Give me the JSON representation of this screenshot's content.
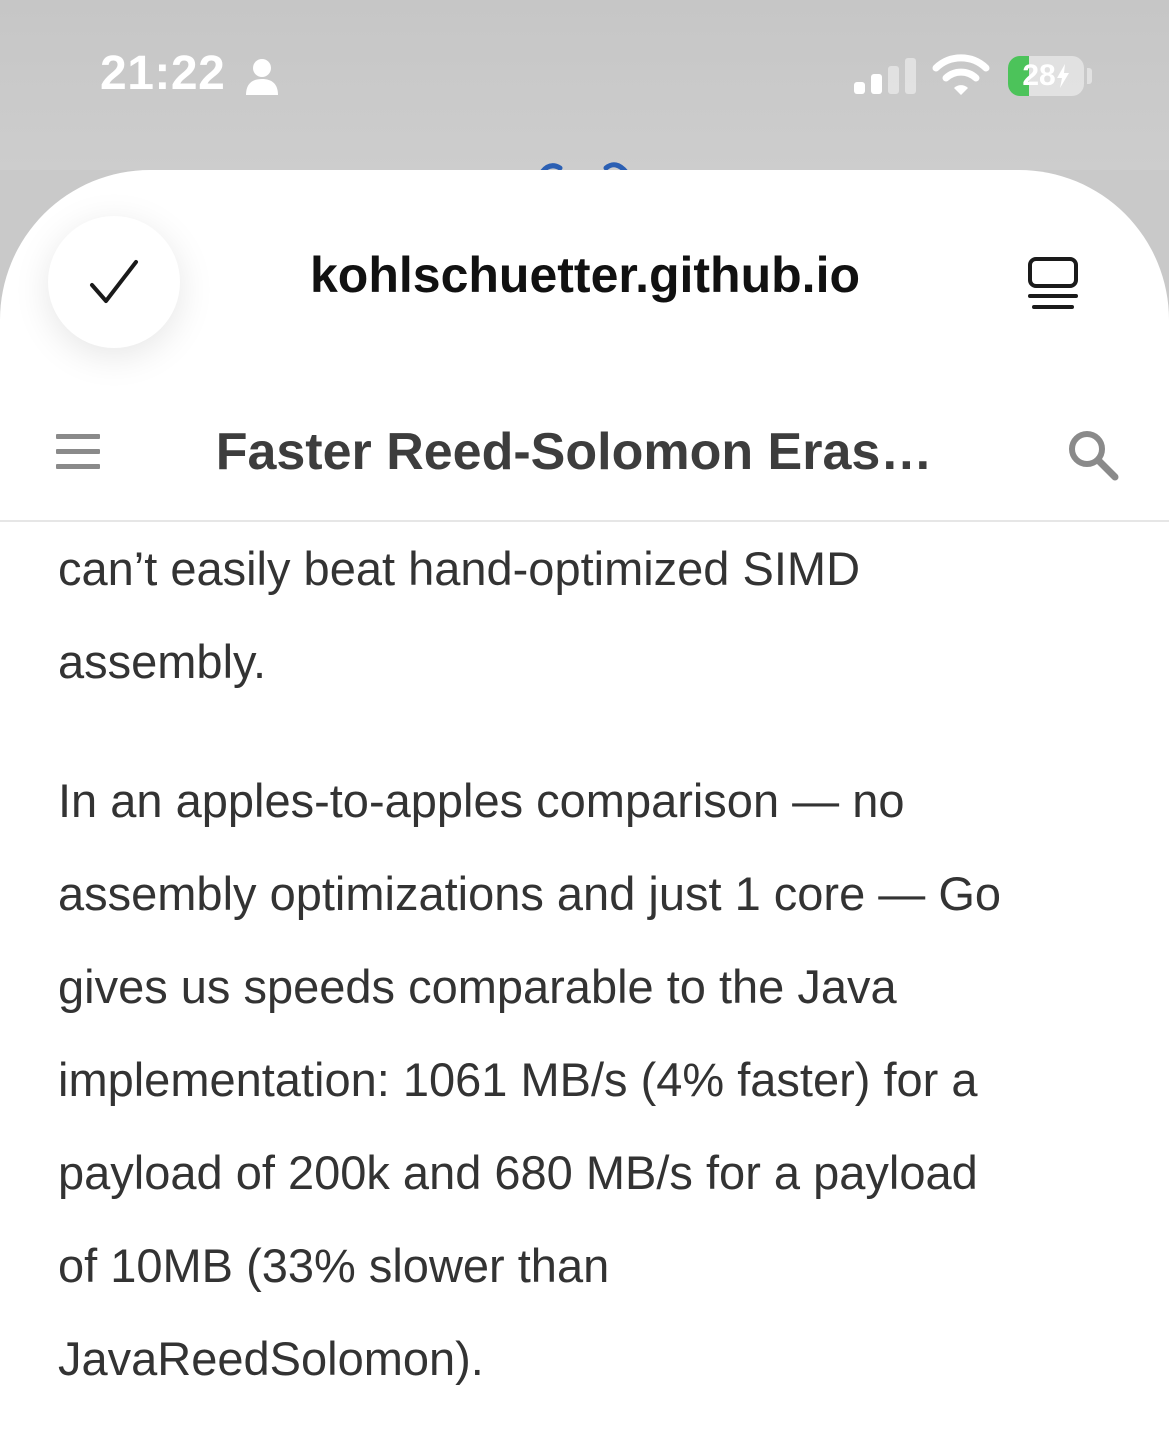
{
  "status_bar": {
    "time": "21:22",
    "battery_level": "28",
    "battery_percent": 28,
    "battery_color": "#4cc35a",
    "signal_bars_active": 2,
    "icons": [
      "person-icon",
      "signal-icon",
      "wifi-icon",
      "battery-icon",
      "charging-bolt-icon"
    ]
  },
  "browser": {
    "url": "kohlschuetter.github.io",
    "icons": [
      "checkmark-icon",
      "reader-view-icon"
    ]
  },
  "page_header": {
    "title": "Faster Reed-Solomon Eras…",
    "icons": [
      "hamburger-menu-icon",
      "search-icon"
    ]
  },
  "article": {
    "lines": [
      "can’t easily beat hand-optimized SIMD",
      "assembly.",
      "In an apples-to-apples comparison — no",
      "assembly optimizations and just 1 core — Go",
      "gives us speeds comparable to the Java",
      "implementation: 1061 MB/s (4% faster) for a",
      "payload of 200k and 680 MB/s for a payload",
      "of 10MB (33% slower than",
      "JavaReedSolomon)."
    ]
  }
}
